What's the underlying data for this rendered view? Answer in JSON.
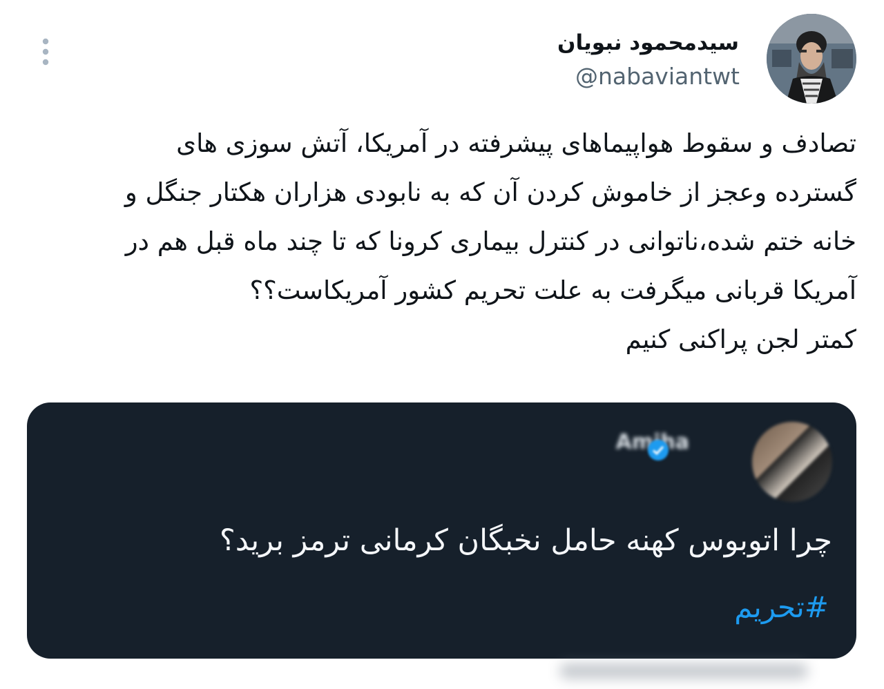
{
  "author": {
    "display_name": "سیدمحمود نبویان",
    "handle": "@nabaviantwt",
    "avatar_icon": "profile-photo-icon"
  },
  "tweet": {
    "text": "تصادف و سقوط هواپیماهای پیشرفته در آمریکا، آتش سوزی های\nگسترده  وعجز از خاموش کردن آن که به نابودی هزاران هکتار جنگل و\nخانه ختم شده،ناتوانی در  کنترل بیماری کرونا که تا چند ماه قبل هم در\nآمریکا قربانی میگرفت  به علت تحریم کشور آمریکاست؟؟\nکمتر لجن پراکنی کنیم"
  },
  "quoted_tweet": {
    "author_name": "Amiha",
    "verified_icon": "verified-badge-icon",
    "text": "چرا اتوبوس کهنه حامل نخبگان کرمانی ترمز برید؟",
    "hashtag": "#تحریم"
  },
  "icons": {
    "more": "more-options-icon"
  },
  "colors": {
    "quote_background": "#16202b",
    "link_blue": "#1d9bf0",
    "secondary_text": "#536471"
  }
}
